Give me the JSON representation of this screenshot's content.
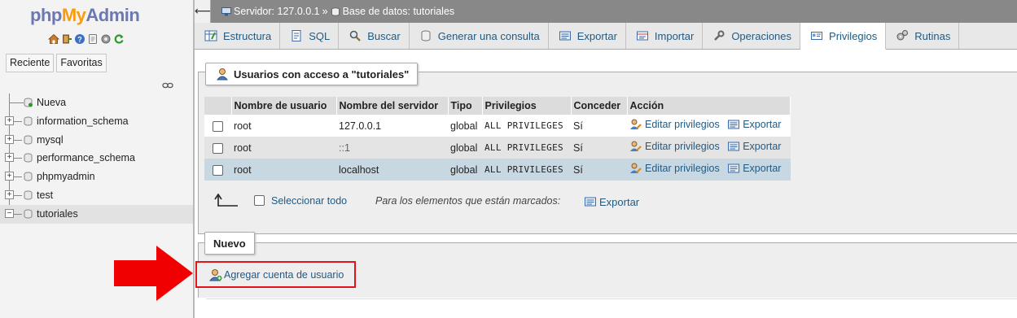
{
  "logo": {
    "php": "php",
    "my": "My",
    "admin": "Admin"
  },
  "nav_icons": [
    "home-icon",
    "exit-icon",
    "help-icon",
    "docs-icon",
    "settings-icon",
    "reload-icon"
  ],
  "nav_tabs": {
    "recent": "Reciente",
    "favorites": "Favoritas"
  },
  "tree": [
    {
      "label": "Nueva",
      "type": "new"
    },
    {
      "label": "information_schema",
      "type": "db"
    },
    {
      "label": "mysql",
      "type": "db"
    },
    {
      "label": "performance_schema",
      "type": "db"
    },
    {
      "label": "phpmyadmin",
      "type": "db"
    },
    {
      "label": "test",
      "type": "db"
    },
    {
      "label": "tutoriales",
      "type": "db",
      "active": true
    }
  ],
  "breadcrumb": {
    "server": "Servidor: 127.0.0.1",
    "sep": "»",
    "database": "Base de datos: tutoriales"
  },
  "tabs": [
    {
      "label": "Estructura",
      "icon": "structure-icon"
    },
    {
      "label": "SQL",
      "icon": "sql-icon"
    },
    {
      "label": "Buscar",
      "icon": "search-icon"
    },
    {
      "label": "Generar una consulta",
      "icon": "query-icon"
    },
    {
      "label": "Exportar",
      "icon": "export-icon"
    },
    {
      "label": "Importar",
      "icon": "import-icon"
    },
    {
      "label": "Operaciones",
      "icon": "wrench-icon"
    },
    {
      "label": "Privilegios",
      "icon": "privileges-icon",
      "active": true
    },
    {
      "label": "Rutinas",
      "icon": "routines-icon"
    }
  ],
  "users_section": {
    "legend": "Usuarios con acceso a \"tutoriales\"",
    "columns": [
      "Nombre de usuario",
      "Nombre del servidor",
      "Tipo",
      "Privilegios",
      "Conceder",
      "Acción"
    ],
    "rows": [
      {
        "user": "root",
        "host": "127.0.0.1",
        "type": "global",
        "privileges": "ALL PRIVILEGES",
        "grant": "Sí",
        "edit": "Editar privilegios",
        "export": "Exportar"
      },
      {
        "user": "root",
        "host": "::1",
        "type": "global",
        "privileges": "ALL PRIVILEGES",
        "grant": "Sí",
        "edit": "Editar privilegios",
        "export": "Exportar"
      },
      {
        "user": "root",
        "host": "localhost",
        "type": "global",
        "privileges": "ALL PRIVILEGES",
        "grant": "Sí",
        "edit": "Editar privilegios",
        "export": "Exportar"
      }
    ],
    "select_all": "Seleccionar todo",
    "marked_label": "Para los elementos que están marcados:",
    "export_label": "Exportar"
  },
  "new_section": {
    "legend": "Nuevo",
    "add_user": "Agregar cuenta de usuario"
  },
  "colors": {
    "link": "#235a81",
    "highlight_box": "#e0141a",
    "arrow": "#f00000",
    "topbar": "#888888"
  }
}
